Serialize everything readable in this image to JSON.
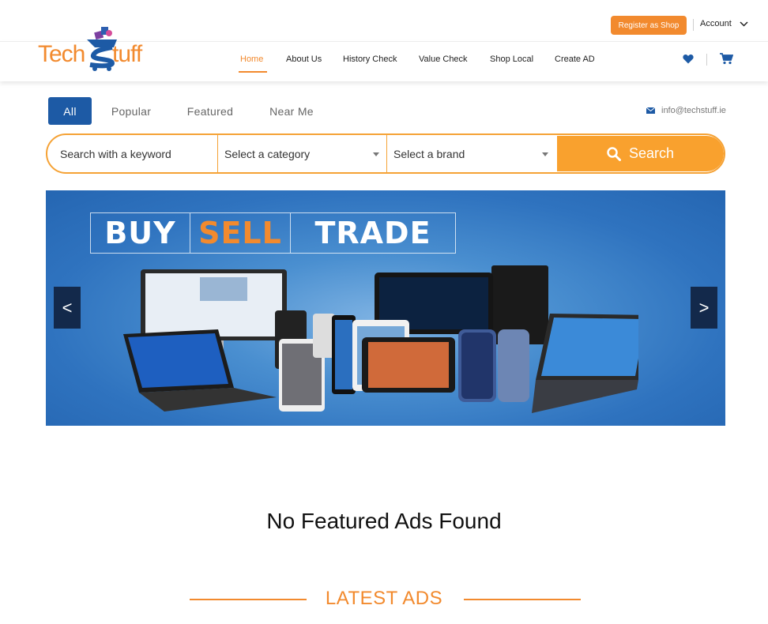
{
  "header": {
    "register_label": "Register as Shop",
    "account_label": "Account",
    "logo": {
      "part1": "Tech",
      "part2": "tuff",
      "brand_orange": "#f28a2e",
      "brand_blue": "#1d5aa5"
    }
  },
  "nav": {
    "items": [
      {
        "label": "Home",
        "active": true
      },
      {
        "label": "About Us",
        "active": false
      },
      {
        "label": "History Check",
        "active": false
      },
      {
        "label": "Value Check",
        "active": false
      },
      {
        "label": "Shop Local",
        "active": false
      },
      {
        "label": "Create AD",
        "active": false
      }
    ],
    "icons": [
      "heart-icon",
      "cart-icon"
    ]
  },
  "tabs": [
    {
      "label": "All",
      "active": true
    },
    {
      "label": "Popular",
      "active": false
    },
    {
      "label": "Featured",
      "active": false
    },
    {
      "label": "Near Me",
      "active": false
    }
  ],
  "contact": {
    "email": "info@techstuff.ie"
  },
  "search": {
    "placeholder": "Search with a keyword",
    "category_label": "Select a category",
    "brand_label": "Select a brand",
    "button_label": "Search"
  },
  "banner": {
    "words": [
      "BUY",
      "SELL",
      "TRADE"
    ],
    "prev_label": "<",
    "next_label": ">"
  },
  "content": {
    "no_featured": "No Featured Ads Found",
    "latest_heading": "LATEST ADS"
  }
}
